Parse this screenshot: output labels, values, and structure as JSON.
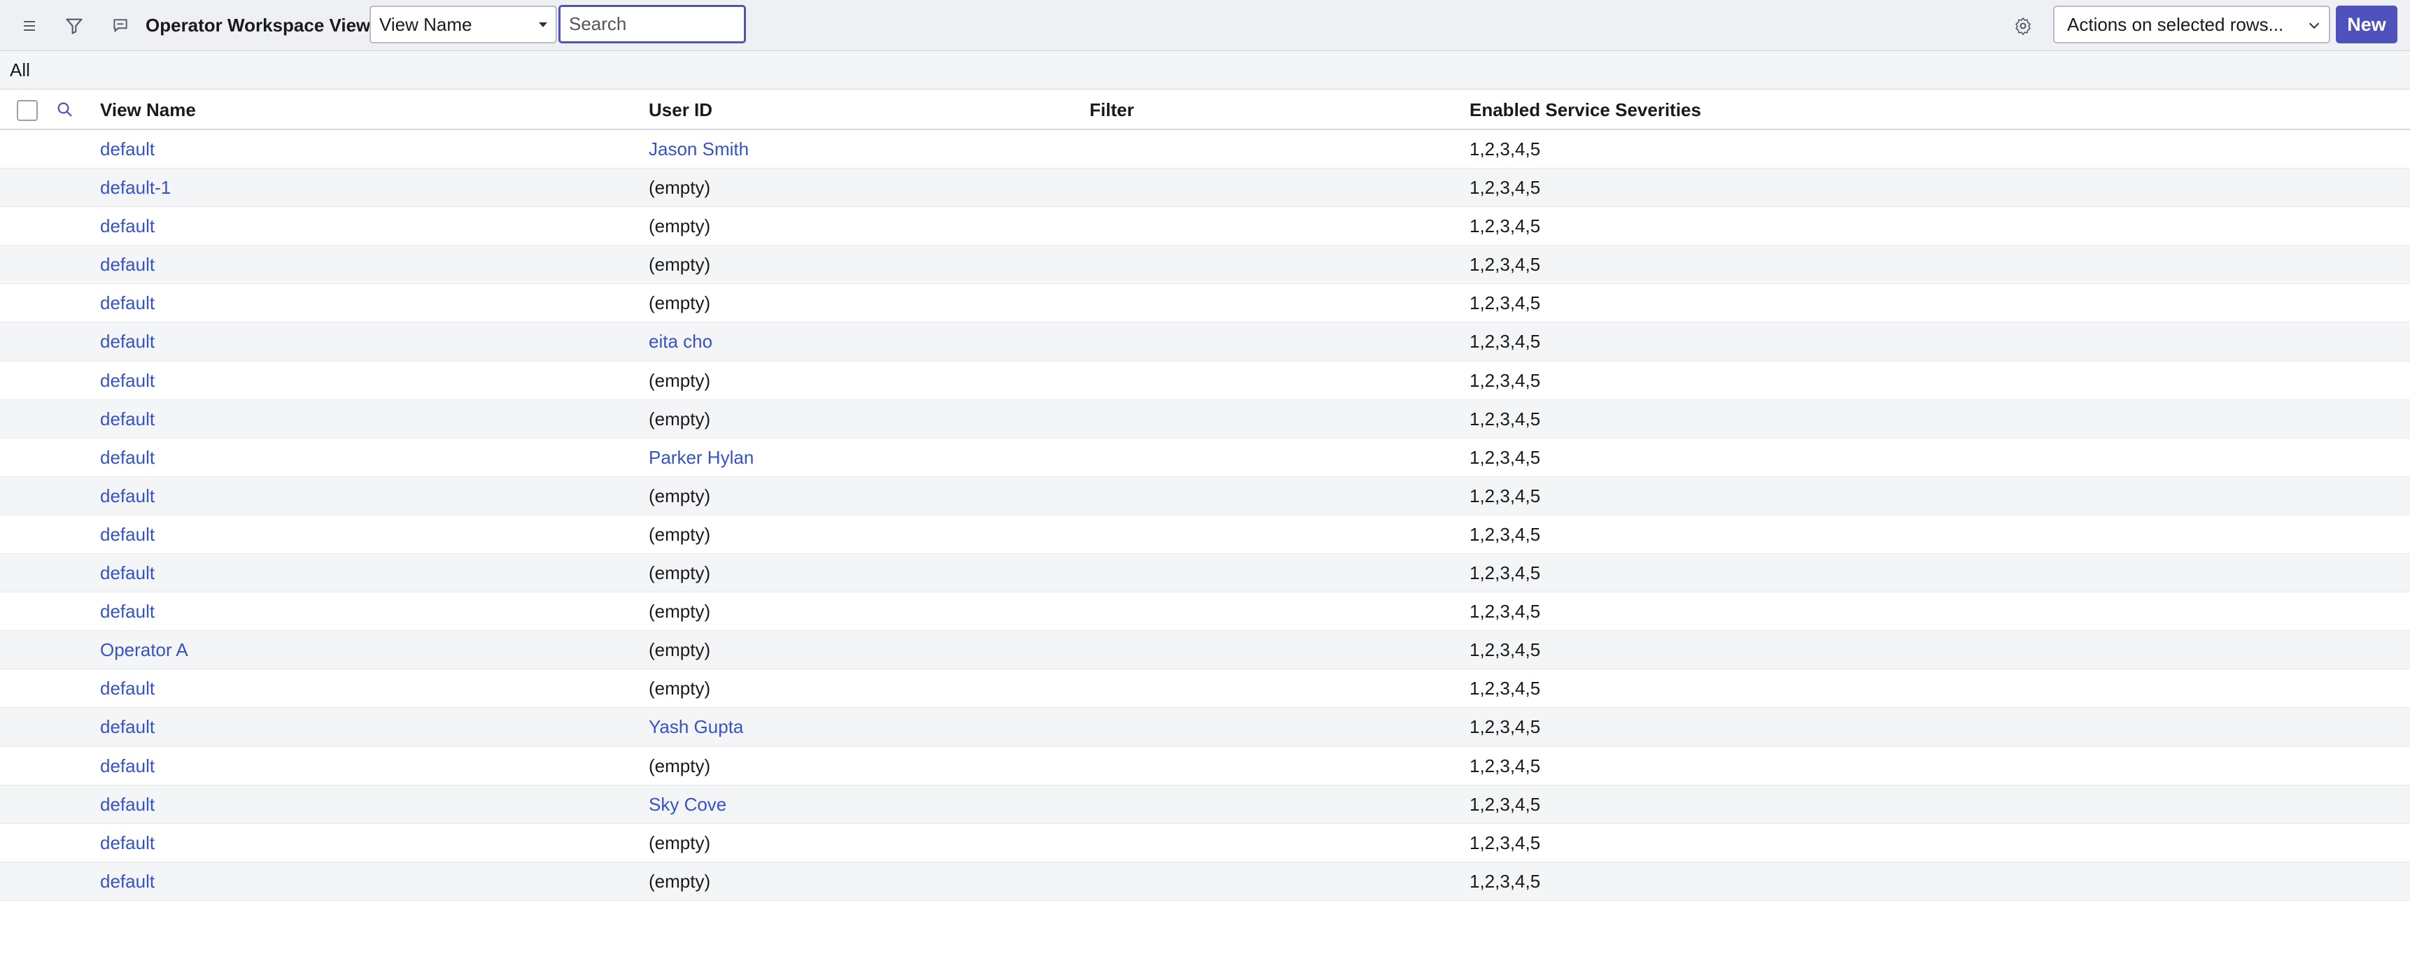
{
  "header": {
    "title": "Operator Workspace Views",
    "field_select": "View Name",
    "search_placeholder": "Search",
    "actions_select": "Actions on selected rows...",
    "new_label": "New",
    "icons": [
      "menu-icon",
      "filter-icon",
      "chat-icon",
      "gear-icon"
    ]
  },
  "breadcrumb": {
    "label": "All"
  },
  "table": {
    "columns": [
      "View Name",
      "User ID",
      "Filter",
      "Enabled Service Severities"
    ],
    "rows": [
      {
        "name": "default",
        "user": "Jason Smith",
        "user_is_link": true,
        "filter": "",
        "sev": "1,2,3,4,5"
      },
      {
        "name": "default-1",
        "user": "(empty)",
        "user_is_link": false,
        "filter": "",
        "sev": "1,2,3,4,5"
      },
      {
        "name": "default",
        "user": "(empty)",
        "user_is_link": false,
        "filter": "",
        "sev": "1,2,3,4,5"
      },
      {
        "name": "default",
        "user": "(empty)",
        "user_is_link": false,
        "filter": "",
        "sev": "1,2,3,4,5"
      },
      {
        "name": "default",
        "user": "(empty)",
        "user_is_link": false,
        "filter": "",
        "sev": "1,2,3,4,5"
      },
      {
        "name": "default",
        "user": "eita cho",
        "user_is_link": true,
        "filter": "",
        "sev": "1,2,3,4,5"
      },
      {
        "name": "default",
        "user": "(empty)",
        "user_is_link": false,
        "filter": "",
        "sev": "1,2,3,4,5"
      },
      {
        "name": "default",
        "user": "(empty)",
        "user_is_link": false,
        "filter": "",
        "sev": "1,2,3,4,5"
      },
      {
        "name": "default",
        "user": "Parker Hylan",
        "user_is_link": true,
        "filter": "",
        "sev": "1,2,3,4,5"
      },
      {
        "name": "default",
        "user": "(empty)",
        "user_is_link": false,
        "filter": "",
        "sev": "1,2,3,4,5"
      },
      {
        "name": "default",
        "user": "(empty)",
        "user_is_link": false,
        "filter": "",
        "sev": "1,2,3,4,5"
      },
      {
        "name": "default",
        "user": "(empty)",
        "user_is_link": false,
        "filter": "",
        "sev": "1,2,3,4,5"
      },
      {
        "name": "default",
        "user": "(empty)",
        "user_is_link": false,
        "filter": "",
        "sev": "1,2,3,4,5"
      },
      {
        "name": "Operator A",
        "user": "(empty)",
        "user_is_link": false,
        "filter": "",
        "sev": "1,2,3,4,5"
      },
      {
        "name": "default",
        "user": "(empty)",
        "user_is_link": false,
        "filter": "",
        "sev": "1,2,3,4,5"
      },
      {
        "name": "default",
        "user": "Yash Gupta",
        "user_is_link": true,
        "filter": "",
        "sev": "1,2,3,4,5"
      },
      {
        "name": "default",
        "user": "(empty)",
        "user_is_link": false,
        "filter": "",
        "sev": "1,2,3,4,5"
      },
      {
        "name": "default",
        "user": "Sky Cove",
        "user_is_link": true,
        "filter": "",
        "sev": "1,2,3,4,5"
      },
      {
        "name": "default",
        "user": "(empty)",
        "user_is_link": false,
        "filter": "",
        "sev": "1,2,3,4,5"
      },
      {
        "name": "default",
        "user": "(empty)",
        "user_is_link": false,
        "filter": "",
        "sev": "1,2,3,4,5"
      }
    ]
  },
  "colors": {
    "accent": "#4f52bd",
    "link": "#3553c7",
    "header_bg": "#eef0f4",
    "stripe": "#f4f5f7"
  }
}
